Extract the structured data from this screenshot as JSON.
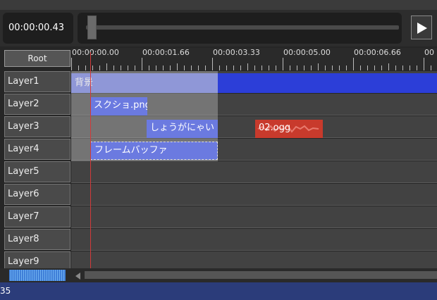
{
  "transport": {
    "time": "00:00:00.43",
    "seek_position_fraction": 0.02
  },
  "root_label": "Root",
  "ruler": {
    "ticks": [
      "00:00:00.00",
      "00:00:01.66",
      "00:00:03.33",
      "00:00:05.00",
      "00:00:06.66",
      "00"
    ]
  },
  "layers": [
    "Layer1",
    "Layer2",
    "Layer3",
    "Layer4",
    "Layer5",
    "Layer6",
    "Layer7",
    "Layer8",
    "Layer9"
  ],
  "clips": {
    "background": "背景",
    "image": "スクショ.png",
    "text": "しょうがにゃい",
    "audio": "02.ogg",
    "buffer": "フレームバッファ"
  },
  "status": {
    "text": "35"
  },
  "colors": {
    "clip_blue": "#2c3ed8",
    "clip_light": "#6b7ae0",
    "audio_red": "#c83a2c",
    "playhead": "#d23a3a",
    "status_bar": "#2b3c7a"
  }
}
